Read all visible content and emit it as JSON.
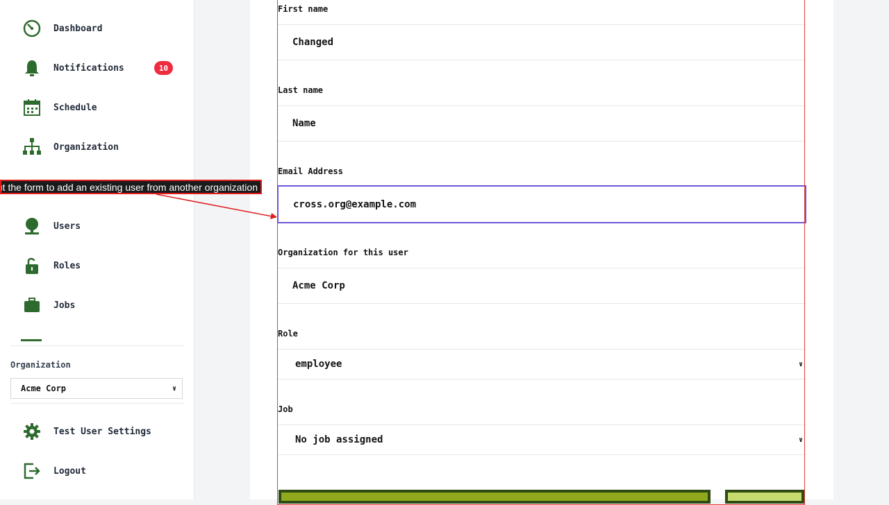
{
  "sidebar": {
    "items": [
      {
        "label": "Dashboard",
        "icon": "dashboard-icon"
      },
      {
        "label": "Notifications",
        "icon": "bell-icon",
        "badge": "10"
      },
      {
        "label": "Schedule",
        "icon": "calendar-icon"
      },
      {
        "label": "Organization",
        "icon": "org-chart-icon"
      },
      {
        "label": "Users",
        "icon": "user-icon"
      },
      {
        "label": "Roles",
        "icon": "lock-icon"
      },
      {
        "label": "Jobs",
        "icon": "briefcase-icon"
      }
    ],
    "organization_label": "Organization",
    "organization_value": "Acme Corp",
    "bottom_items": [
      {
        "label": "Test User Settings",
        "icon": "gear-icon"
      },
      {
        "label": "Logout",
        "icon": "logout-icon"
      }
    ]
  },
  "form": {
    "first_name": {
      "label": "First name",
      "value": "Changed"
    },
    "last_name": {
      "label": "Last name",
      "value": "Name"
    },
    "email": {
      "label": "Email Address",
      "value": "cross.org@example.com"
    },
    "organization": {
      "label": "Organization for this user",
      "value": "Acme Corp"
    },
    "role": {
      "label": "Role",
      "value": "employee"
    },
    "job": {
      "label": "Job",
      "value": "No job assigned"
    }
  },
  "annotation": {
    "text": "ut the form to add an existing user from another organization"
  },
  "colors": {
    "accent": "#2d6a2d",
    "badge": "#ef2b3f",
    "focus": "#6d55d9",
    "annotation_border": "#e11d1d"
  }
}
